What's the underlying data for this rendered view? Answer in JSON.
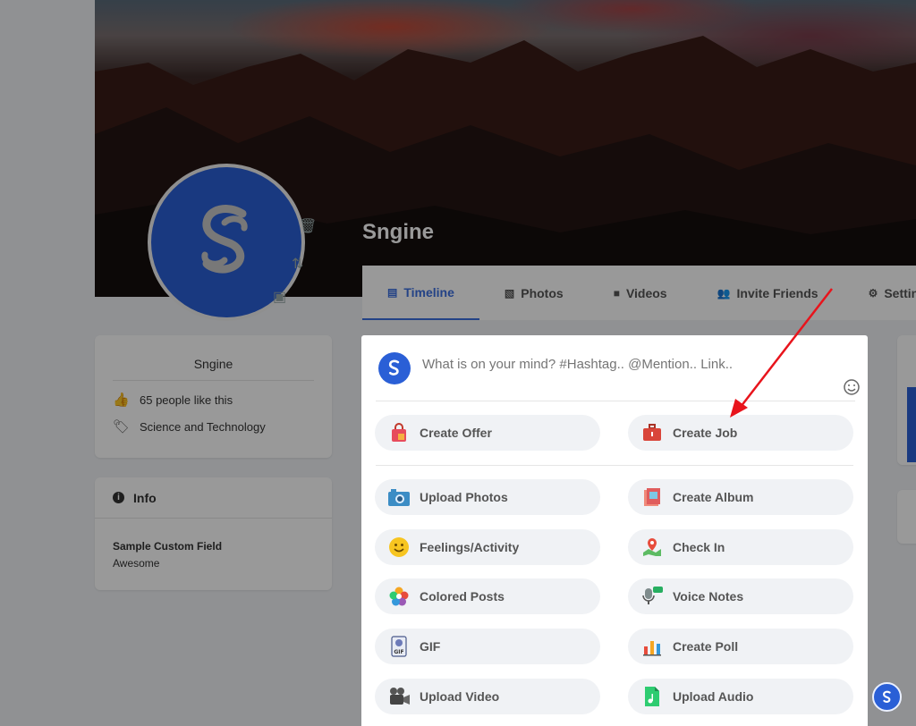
{
  "page": {
    "name": "Sngine"
  },
  "tabs": [
    {
      "label": "Timeline",
      "icon": "timeline-icon"
    },
    {
      "label": "Photos",
      "icon": "photos-icon"
    },
    {
      "label": "Videos",
      "icon": "video-camera-icon"
    },
    {
      "label": "Invite Friends",
      "icon": "user-plus-icon"
    },
    {
      "label": "Settings",
      "icon": "gear-icon"
    }
  ],
  "about": {
    "title": "Sngine",
    "likes": "65 people like this",
    "category": "Science and Technology"
  },
  "info": {
    "title": "Info",
    "field_label": "Sample Custom Field",
    "field_value": "Awesome"
  },
  "publisher": {
    "placeholder": "What is on your mind? #Hashtag.. @Mention.. Link..",
    "options": [
      {
        "label": "Create Offer",
        "icon": "shopping-bag-icon"
      },
      {
        "label": "Create Job",
        "icon": "briefcase-icon"
      },
      {
        "label": "Upload Photos",
        "icon": "camera-icon"
      },
      {
        "label": "Create Album",
        "icon": "album-icon"
      },
      {
        "label": "Feelings/Activity",
        "icon": "smiley-icon"
      },
      {
        "label": "Check In",
        "icon": "map-pin-icon"
      },
      {
        "label": "Colored Posts",
        "icon": "flower-icon"
      },
      {
        "label": "Voice Notes",
        "icon": "microphone-icon"
      },
      {
        "label": "GIF",
        "icon": "gif-icon"
      },
      {
        "label": "Create Poll",
        "icon": "poll-icon"
      },
      {
        "label": "Upload Video",
        "icon": "movie-camera-icon"
      },
      {
        "label": "Upload Audio",
        "icon": "audio-file-icon"
      }
    ]
  },
  "colors": {
    "brand_blue": "#2a5fd6",
    "tab_active": "#3b6fe0",
    "annotation_arrow": "#e8141c"
  }
}
